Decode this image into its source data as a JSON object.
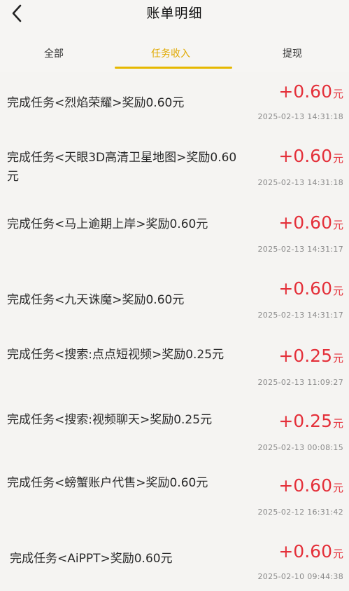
{
  "header": {
    "title": "账单明细"
  },
  "tabs": [
    {
      "label": "全部"
    },
    {
      "label": "任务收入"
    },
    {
      "label": "提现"
    }
  ],
  "active_tab": "任务收入",
  "colors": {
    "amount": "#e4303a",
    "active_tab": "#e0a900",
    "indicator": "#e6b800"
  },
  "records": [
    {
      "description": "完成任务<烈焰荣耀>奖励0.60元",
      "amount": "+0.60",
      "unit": "元",
      "time": "2025-02-13 14:31:18"
    },
    {
      "description": "完成任务<天眼3D高清卫星地图>奖励0.60元",
      "amount": "+0.60",
      "unit": "元",
      "time": "2025-02-13 14:31:18"
    },
    {
      "description": "完成任务<马上逾期上岸>奖励0.60元",
      "amount": "+0.60",
      "unit": "元",
      "time": "2025-02-13 14:31:17"
    },
    {
      "description": "完成任务<九天诛魔>奖励0.60元",
      "amount": "+0.60",
      "unit": "元",
      "time": "2025-02-13 14:31:17"
    },
    {
      "description": "完成任务<搜索:点点短视频>奖励0.25元",
      "amount": "+0.25",
      "unit": "元",
      "time": "2025-02-13 11:09:27"
    },
    {
      "description": "完成任务<搜索:视频聊天>奖励0.25元",
      "amount": "+0.25",
      "unit": "元",
      "time": "2025-02-13 00:08:15"
    },
    {
      "description": "完成任务<螃蟹账户代售>奖励0.60元",
      "amount": "+0.60",
      "unit": "元",
      "time": "2025-02-12 16:31:42"
    },
    {
      "description": "完成任务<AiPPT>奖励0.60元",
      "amount": "+0.60",
      "unit": "元",
      "time": "2025-02-10 09:44:38"
    }
  ]
}
